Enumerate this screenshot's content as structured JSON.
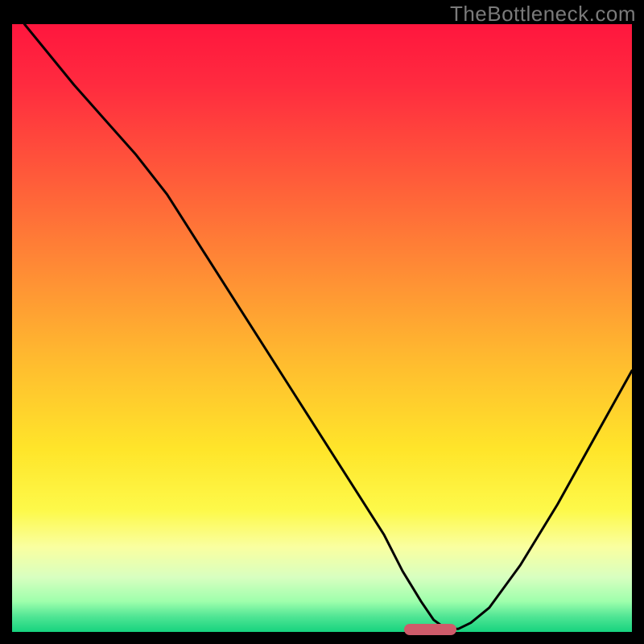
{
  "watermark": "TheBottleneck.com",
  "gradient_stops": [
    {
      "offset": 0.0,
      "color": "#ff163e"
    },
    {
      "offset": 0.1,
      "color": "#ff2b3f"
    },
    {
      "offset": 0.25,
      "color": "#ff5a3a"
    },
    {
      "offset": 0.4,
      "color": "#ff8a35"
    },
    {
      "offset": 0.55,
      "color": "#ffba2f"
    },
    {
      "offset": 0.7,
      "color": "#ffe52a"
    },
    {
      "offset": 0.8,
      "color": "#fdf94a"
    },
    {
      "offset": 0.86,
      "color": "#faffa0"
    },
    {
      "offset": 0.91,
      "color": "#d8ffc0"
    },
    {
      "offset": 0.95,
      "color": "#9effac"
    },
    {
      "offset": 0.975,
      "color": "#4fe594"
    },
    {
      "offset": 1.0,
      "color": "#16d37e"
    }
  ],
  "marker": {
    "x_frac": 0.675,
    "width_frac": 0.085
  },
  "chart_data": {
    "type": "line",
    "title": "",
    "xlabel": "",
    "ylabel": "",
    "xlim": [
      0,
      100
    ],
    "ylim": [
      0,
      100
    ],
    "grid": false,
    "legend": false,
    "note": "Axes unlabeled in source image; values are read off by position as percentages of plot area. y=0 is at bottom (green), y=100 is at top (red). The minimum of the curve sits near x≈70.",
    "series": [
      {
        "name": "curve",
        "x": [
          2,
          10,
          20,
          25,
          30,
          35,
          40,
          45,
          50,
          55,
          60,
          63,
          66,
          68,
          70,
          72,
          74,
          77,
          82,
          88,
          94,
          100
        ],
        "y": [
          100,
          90,
          78.5,
          72,
          64,
          56,
          48,
          40,
          32,
          24,
          16,
          10,
          5,
          2,
          0.5,
          0.5,
          1.5,
          4,
          11,
          21,
          32,
          43
        ]
      }
    ]
  }
}
